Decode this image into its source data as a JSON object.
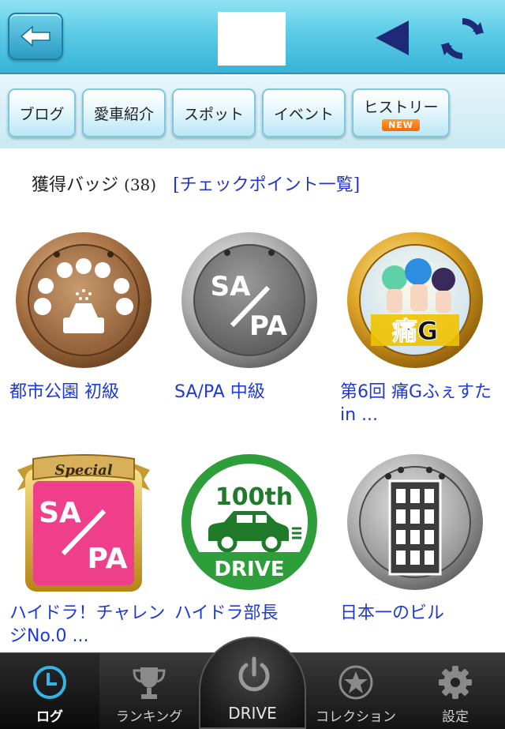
{
  "header": {
    "back_icon": "arrow-left-icon",
    "play_back_icon": "triangle-left-icon",
    "refresh_icon": "refresh-icon"
  },
  "tabs": [
    {
      "label": "ブログ"
    },
    {
      "label": "愛車紹介"
    },
    {
      "label": "スポット"
    },
    {
      "label": "イベント"
    },
    {
      "label": "ヒストリー",
      "badge": "NEW"
    }
  ],
  "badges_section": {
    "title": "獲得バッジ",
    "count": "(38)",
    "checkpoint_link": "[チェックポイント一覧]"
  },
  "badges": [
    {
      "label": "都市公園 初級",
      "icon": "park-bronze-badge"
    },
    {
      "label": "SA/PA 中級",
      "icon": "sapa-silver-badge",
      "badge_text_top": "SA",
      "badge_text_bottom": "PA"
    },
    {
      "label": "第6回 痛Gふぇすた in ...",
      "icon": "anime-gold-badge",
      "badge_text": "痛G"
    },
    {
      "label": "ハイドラ！チャレンジNo.0 ...",
      "icon": "sapa-special-pink-badge",
      "ribbon_text": "Special",
      "badge_text_top": "SA",
      "badge_text_bottom": "PA"
    },
    {
      "label": "ハイドラ部長",
      "icon": "100th-drive-green-badge",
      "badge_text_top": "100th",
      "badge_text_bottom": "DRIVE"
    },
    {
      "label": "日本一のビル",
      "icon": "building-silver-badge"
    }
  ],
  "bottom_nav": [
    {
      "label": "ログ",
      "icon": "clock-icon",
      "active": true
    },
    {
      "label": "ランキング",
      "icon": "trophy-icon"
    },
    {
      "label": "DRIVE",
      "icon": "power-icon"
    },
    {
      "label": "コレクション",
      "icon": "star-circle-icon"
    },
    {
      "label": "設定",
      "icon": "gear-icon"
    }
  ],
  "colors": {
    "header": "#5ccbe6",
    "link": "#2535c8",
    "badge_label": "#1d3ad8",
    "nav_active": "#35b5e6"
  }
}
